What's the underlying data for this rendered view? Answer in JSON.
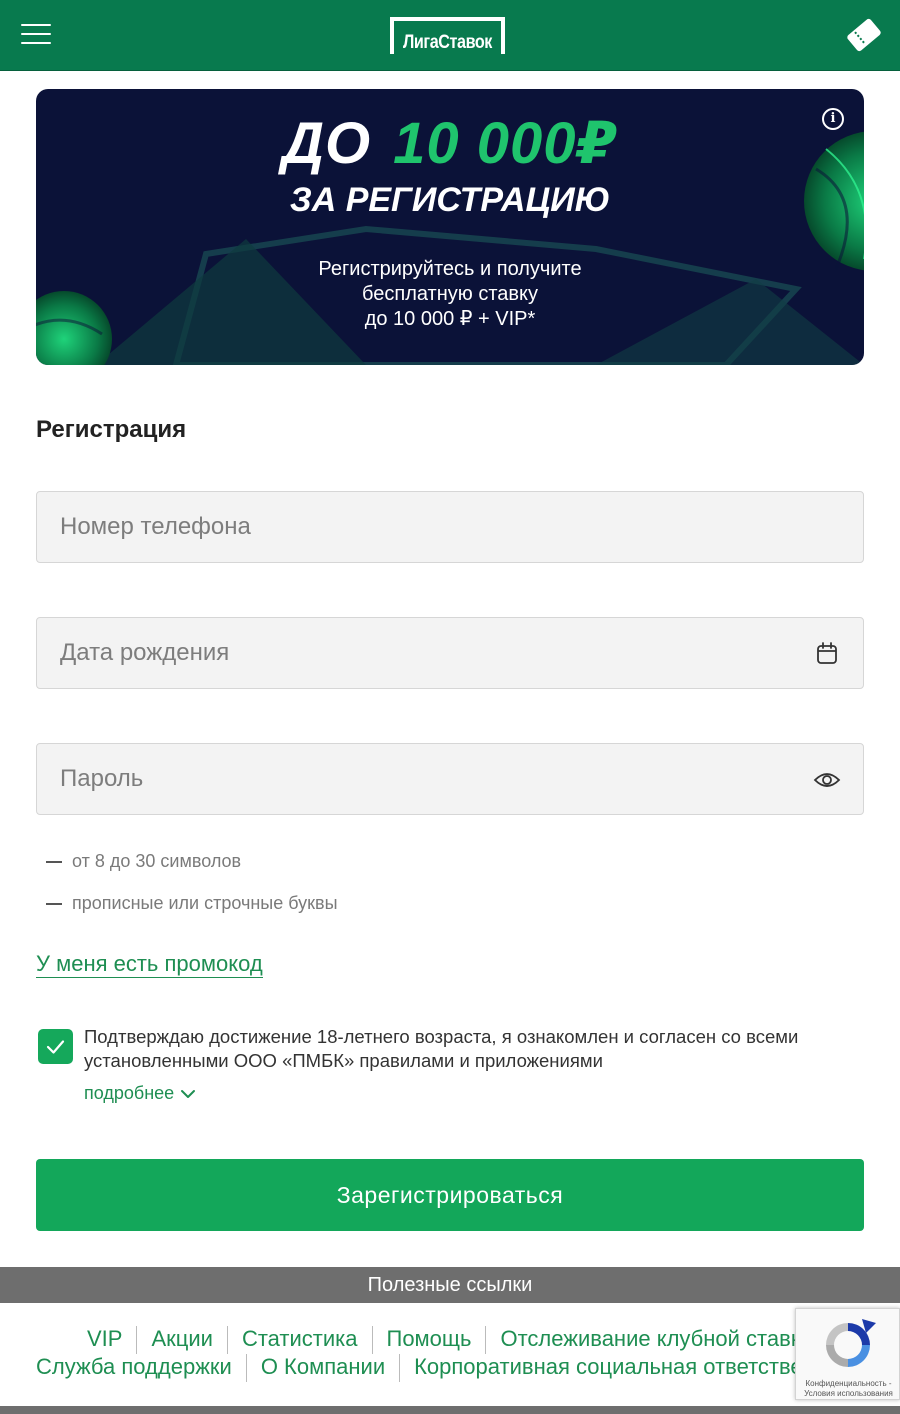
{
  "header": {
    "logo_text": "ЛигаСтавок",
    "menu_icon": "hamburger-menu-icon",
    "coupon_icon": "bet-coupon-icon",
    "bg_color": "#087a4e"
  },
  "banner": {
    "line1_prefix": "ДО",
    "line1_amount": "10 000₽",
    "line2": "ЗА РЕГИСТРАЦИЮ",
    "sub_line1": "Регистрируйтесь и получите",
    "sub_line2": "бесплатную ставку",
    "sub_line3": "до 10 000 ₽ + VIP*",
    "info_symbol": "i",
    "bg_color": "#0b1238",
    "accent_color": "#1fc46d"
  },
  "form": {
    "title": "Регистрация",
    "phone_placeholder": "Номер телефона",
    "birthdate_placeholder": "Дата рождения",
    "password_placeholder": "Пароль",
    "hints": [
      "от 8 до 30 символов",
      "прописные или строчные буквы"
    ],
    "promo_link": "У меня есть промокод",
    "agree_text": "Подтверждаю достижение 18-летнего возраста, я ознакомлен и согласен со всеми установленными ООО «ПМБК» правилами и приложениями",
    "agree_checked": true,
    "more_link": "подробнее",
    "submit_label": "Зарегистрироваться",
    "button_color": "#13a75a"
  },
  "footer": {
    "useful_title": "Полезные ссылки",
    "links_row1": [
      "VIP",
      "Акции",
      "Статистика",
      "Помощь",
      "Отслеживание клубной ставки"
    ],
    "links_row2": [
      "Служба поддержки",
      "О Компании",
      "Корпоративная социальная ответственность"
    ],
    "recaptcha_text": "Конфиденциальность - Условия использования"
  }
}
